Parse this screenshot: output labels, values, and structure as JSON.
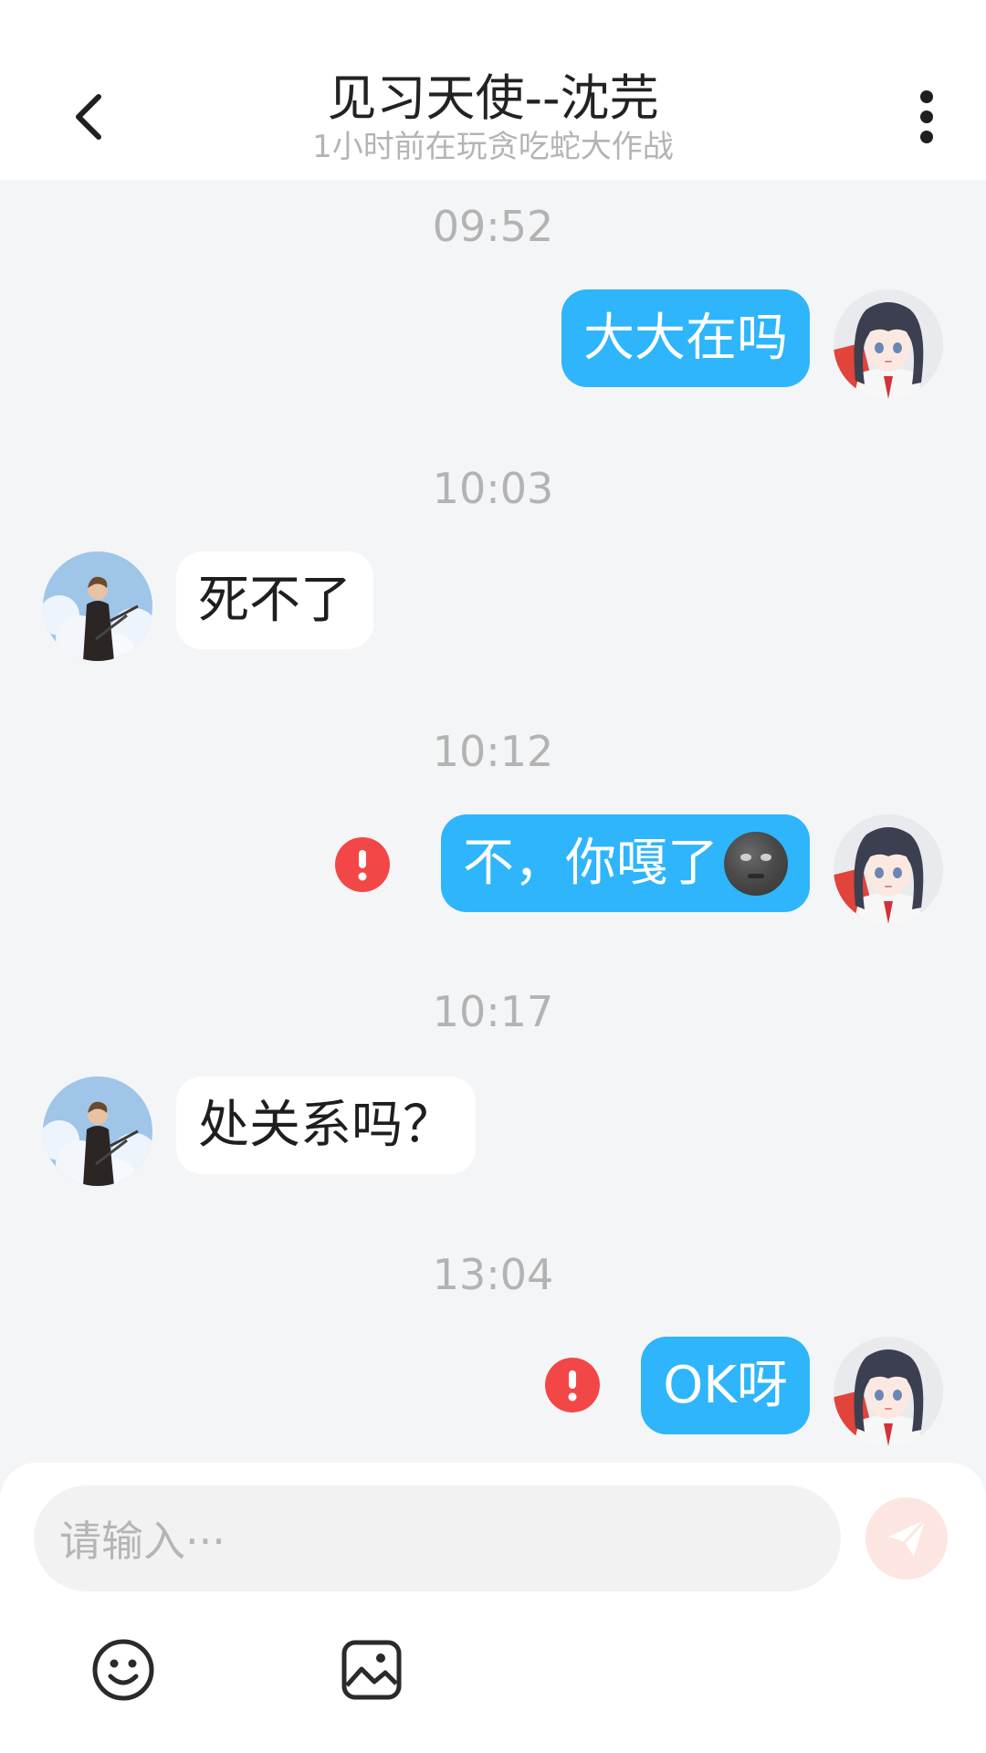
{
  "header": {
    "title": "见习天使--沈芫",
    "subtitle": "1小时前在玩贪吃蛇大作战",
    "back_icon": "chevron-left-icon",
    "more_icon": "more-vertical-icon"
  },
  "messages": [
    {
      "time": "09:52",
      "direction": "out",
      "text": "大大在吗",
      "failed": false
    },
    {
      "time": "10:03",
      "direction": "in",
      "text": "死不了",
      "failed": false
    },
    {
      "time": "10:12",
      "direction": "out",
      "text": "不，你嘎了",
      "emoji": "new-moon-face-emoji",
      "failed": true
    },
    {
      "time": "10:17",
      "direction": "in",
      "text": "处关系吗？",
      "failed": false
    },
    {
      "time": "13:04",
      "direction": "out",
      "text": "OK呀",
      "failed": true
    }
  ],
  "composer": {
    "placeholder": "请输入···",
    "send_icon": "paper-plane-icon",
    "toolbar": [
      "smile-icon",
      "image-icon"
    ]
  },
  "colors": {
    "outgoing_bubble": "#2eb5fb",
    "incoming_bubble": "#ffffff",
    "chat_background": "#f4f5f7",
    "error": "#f34747",
    "send_button": "#fde5e1"
  }
}
